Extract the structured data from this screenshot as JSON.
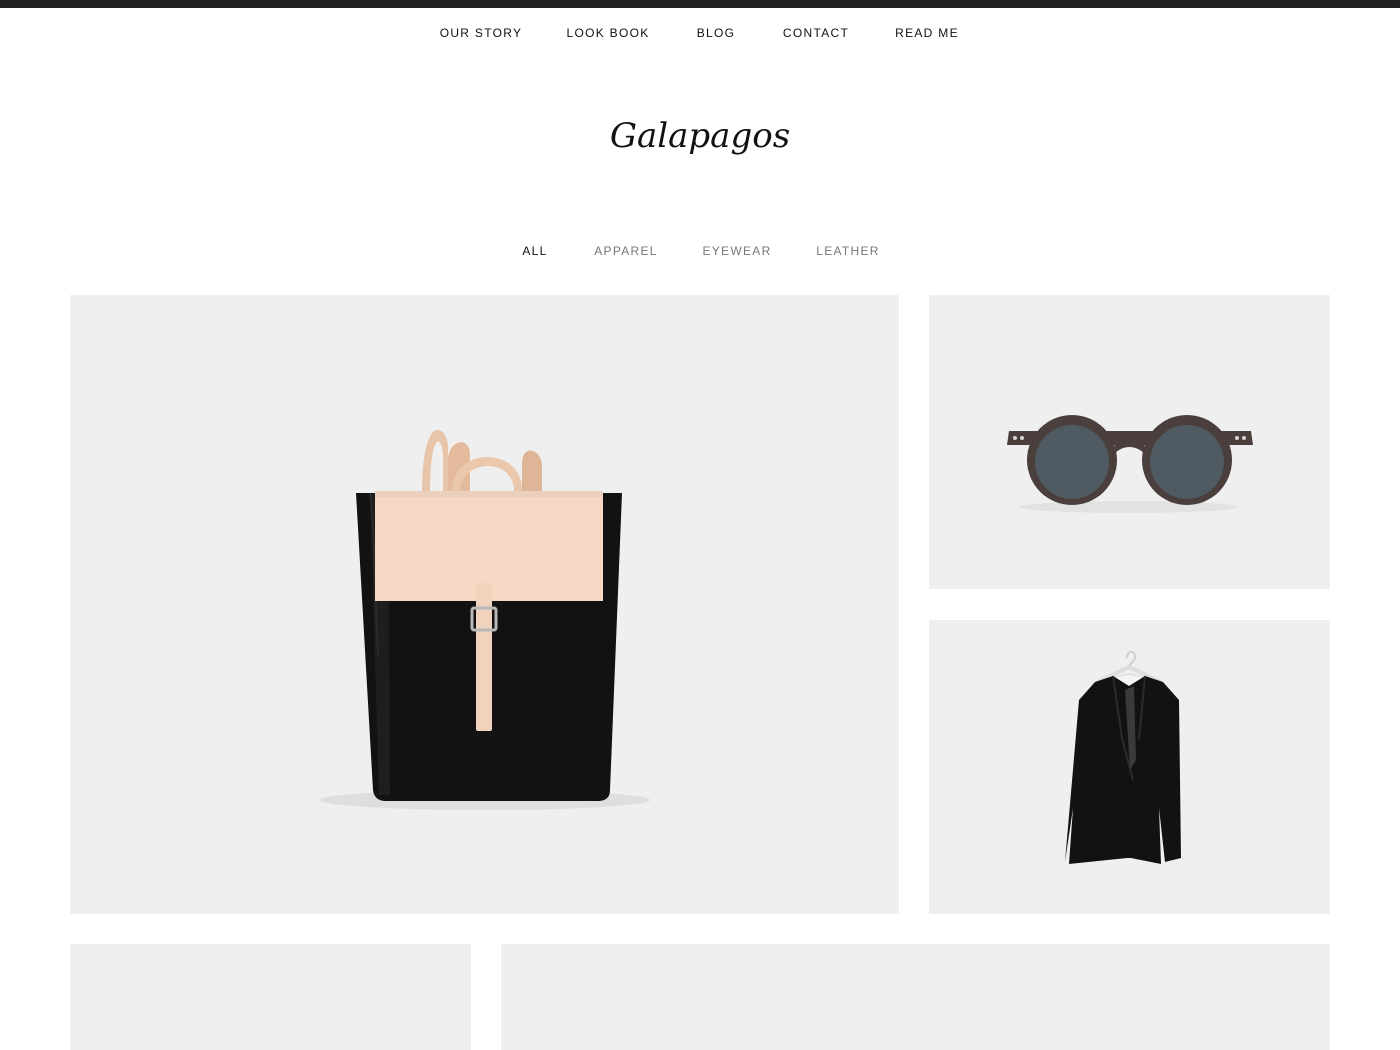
{
  "nav": {
    "items": [
      {
        "label": "OUR STORY"
      },
      {
        "label": "LOOK BOOK"
      },
      {
        "label": "BLOG"
      },
      {
        "label": "CONTACT"
      },
      {
        "label": "READ ME"
      }
    ]
  },
  "brand": {
    "title": "Galapagos"
  },
  "filters": {
    "active": "ALL",
    "items": [
      {
        "label": "ALL"
      },
      {
        "label": "APPAREL"
      },
      {
        "label": "EYEWEAR"
      },
      {
        "label": "LEATHER"
      }
    ]
  },
  "products": [
    {
      "image": "leather-backpack"
    },
    {
      "image": "wooden-sunglasses"
    },
    {
      "image": "black-blazer"
    },
    {
      "image": ""
    },
    {
      "image": ""
    }
  ],
  "colors": {
    "top_bar": "#222222",
    "tile_background": "#efefef",
    "text": "#111111",
    "filter_inactive": "#777777"
  }
}
